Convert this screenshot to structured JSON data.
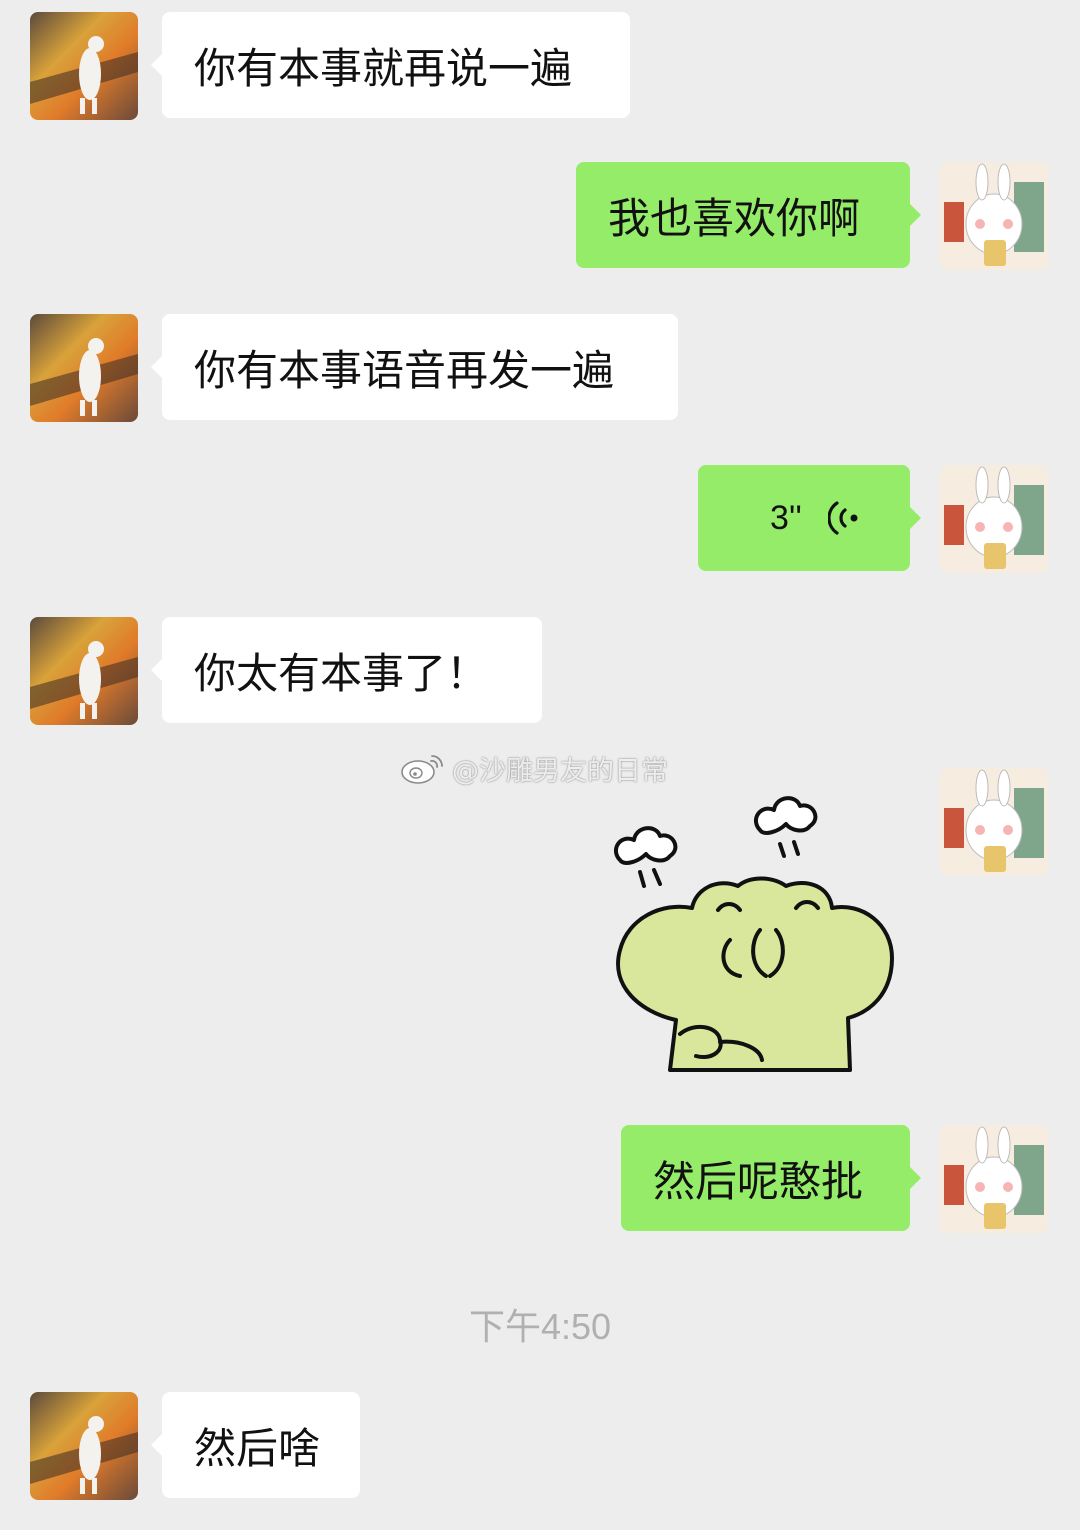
{
  "messages": [
    {
      "side": "left",
      "type": "text",
      "text": "你有本事就再说一遍"
    },
    {
      "side": "right",
      "type": "text",
      "text": "我也喜欢你啊"
    },
    {
      "side": "left",
      "type": "text",
      "text": "你有本事语音再发一遍"
    },
    {
      "side": "right",
      "type": "voice",
      "duration": "3''"
    },
    {
      "side": "left",
      "type": "text",
      "text": "你太有本事了！"
    },
    {
      "side": "right",
      "type": "sticker",
      "sticker": "frog-pouting-sticker"
    },
    {
      "side": "right",
      "type": "text",
      "text": "然后呢憨批"
    },
    {
      "side": "left",
      "type": "text",
      "text": "然后啥"
    }
  ],
  "timestamp": "下午4:50",
  "watermark": "@沙雕男友的日常",
  "colors": {
    "background": "#ededed",
    "incoming_bubble": "#ffffff",
    "outgoing_bubble": "#95ec69"
  },
  "icons": {
    "voice": "voice-wave-icon",
    "weibo": "weibo-logo-icon"
  }
}
